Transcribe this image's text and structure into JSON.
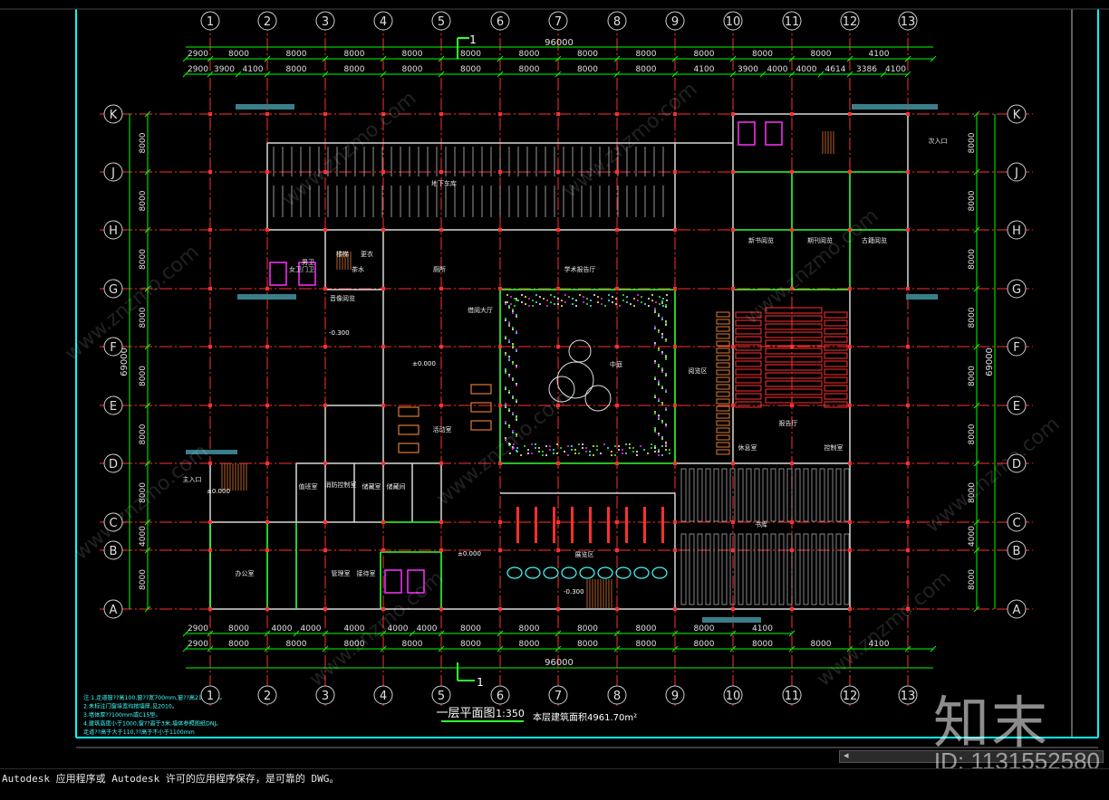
{
  "drawing": {
    "grid_numbers": [
      "1",
      "2",
      "3",
      "4",
      "5",
      "6",
      "7",
      "8",
      "9",
      "10",
      "11",
      "12",
      "13"
    ],
    "grid_letters": [
      "K",
      "J",
      "H",
      "G",
      "F",
      "E",
      "D",
      "C",
      "B",
      "A"
    ],
    "top_total_dim": "96000",
    "bottom_total_dim": "96000",
    "top_dims_row1": [
      "2900",
      "8000",
      "8000",
      "8000",
      "8000",
      "8000",
      "8000",
      "8000",
      "8000",
      "8000",
      "8000",
      "8000",
      "4100"
    ],
    "top_dims_row2": [
      "2900",
      "3900",
      "4100",
      "8000",
      "8000",
      "8000",
      "8000",
      "8000",
      "8000",
      "8000",
      "4100",
      "3900",
      "4000",
      "4000",
      "4614",
      "3386",
      "4100"
    ],
    "bottom_dims_row1": [
      "2900",
      "8000",
      "4000",
      "4000",
      "4000",
      "4000",
      "4000",
      "8000",
      "8000",
      "8000",
      "8000",
      "8000",
      "4100"
    ],
    "bottom_dims_row2": [
      "2900",
      "8000",
      "8000",
      "8000",
      "8000",
      "8000",
      "8000",
      "8000",
      "8000",
      "8000",
      "8000",
      "8000",
      "4100"
    ],
    "side_total_dim": "69000",
    "left_dims_outer": [
      "8000",
      "8000",
      "8000",
      "8000",
      "8000",
      "8000",
      "8000",
      "4000",
      "8000"
    ],
    "right_dims_outer": [
      "8000",
      "8000",
      "8000",
      "8000",
      "8000",
      "8000",
      "8000",
      "4000",
      "8000"
    ],
    "section_mark": "1",
    "plan_title": "一层平面图",
    "plan_scale": "1:350",
    "area_note": "本层建筑面积4961.70m²",
    "notes": [
      "注:1.走道窗??高100,窗??宽700mm,窗??高2100mm。",
      "2.未标注门窗垛宽均按墙厚,见2010。",
      "3.墙体厚??100mm或C15垫。",
      "4.建筑高度小于1000,窗??高于3米,墙体参照图纸DNJ。",
      "  走道??高于大于110,??高于不小于1100mm"
    ],
    "room_labels": [
      "地下车库",
      "门卫",
      "女卫",
      "男卫",
      "楼梯",
      "更衣",
      "茶水",
      "厕所",
      "借阅大厅",
      "中庭",
      "阅览区",
      "学术报告厅",
      "报告厅",
      "休息室",
      "控制室",
      "展览区",
      "书库",
      "办公室",
      "管理室",
      "接待室",
      "储藏室",
      "值班室",
      "消防控制室",
      "储藏间",
      "新书阅览",
      "期刊阅览",
      "古籍阅览",
      "音像阅览",
      "主入口",
      "次入口",
      "活动室"
    ],
    "elevations": [
      "±0.000",
      "-0.300",
      "±0.000",
      "±0.000",
      "-0.300"
    ]
  },
  "status": {
    "message": "Autodesk 应用程序或 Autodesk 许可的应用程序保存，是可靠的 DWG。"
  },
  "watermark": {
    "logo": "知末",
    "id_text": "ID: 1131552580",
    "site": "www.znzmo.com"
  },
  "colors": {
    "background": "#000000",
    "frame": "#00ffff",
    "grid_axis": "#ff3030",
    "dim_line": "#00ff00",
    "wall": "#d8d8d8",
    "column": "#ff3030",
    "magenta": "#ff30ff",
    "yellow": "#ffff40",
    "cyan_text": "#40ffff",
    "green_wall": "#30ff30"
  }
}
